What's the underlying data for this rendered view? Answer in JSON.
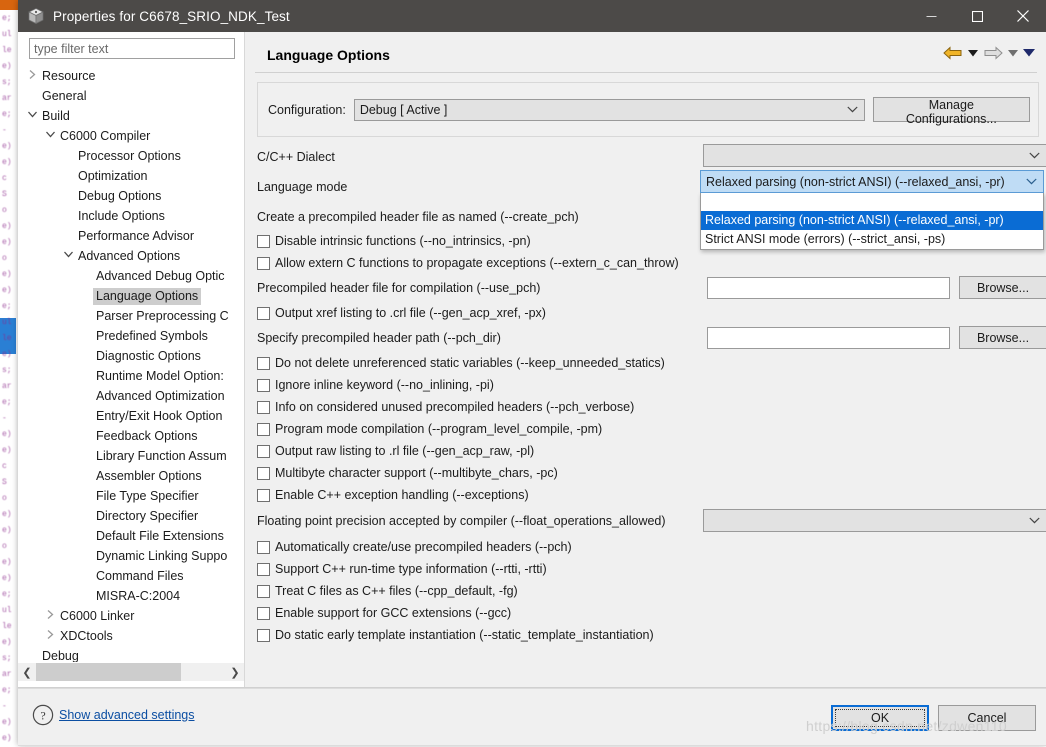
{
  "window": {
    "title": "Properties for C6678_SRIO_NDK_Test",
    "icon": "cube-icon",
    "controls": {
      "minimize": "—",
      "maximize": "☐",
      "close": "✕"
    }
  },
  "sidebar": {
    "filter_placeholder": "type filter text",
    "filter_value": "",
    "items": [
      {
        "label": "Resource",
        "indent": 0,
        "twisty": "collapsed",
        "selected": false
      },
      {
        "label": "General",
        "indent": 0,
        "twisty": "none",
        "selected": false
      },
      {
        "label": "Build",
        "indent": 0,
        "twisty": "expanded",
        "selected": false
      },
      {
        "label": "C6000 Compiler",
        "indent": 1,
        "twisty": "expanded",
        "selected": false
      },
      {
        "label": "Processor Options",
        "indent": 2,
        "twisty": "none",
        "selected": false
      },
      {
        "label": "Optimization",
        "indent": 2,
        "twisty": "none",
        "selected": false
      },
      {
        "label": "Debug Options",
        "indent": 2,
        "twisty": "none",
        "selected": false
      },
      {
        "label": "Include Options",
        "indent": 2,
        "twisty": "none",
        "selected": false
      },
      {
        "label": "Performance Advisor",
        "indent": 2,
        "twisty": "none",
        "selected": false
      },
      {
        "label": "Advanced Options",
        "indent": 2,
        "twisty": "expanded",
        "selected": false
      },
      {
        "label": "Advanced Debug Optic",
        "indent": 3,
        "twisty": "none",
        "selected": false
      },
      {
        "label": "Language Options",
        "indent": 3,
        "twisty": "none",
        "selected": true
      },
      {
        "label": "Parser Preprocessing C",
        "indent": 3,
        "twisty": "none",
        "selected": false
      },
      {
        "label": "Predefined Symbols",
        "indent": 3,
        "twisty": "none",
        "selected": false
      },
      {
        "label": "Diagnostic Options",
        "indent": 3,
        "twisty": "none",
        "selected": false
      },
      {
        "label": "Runtime Model Option:",
        "indent": 3,
        "twisty": "none",
        "selected": false
      },
      {
        "label": "Advanced Optimization",
        "indent": 3,
        "twisty": "none",
        "selected": false
      },
      {
        "label": "Entry/Exit Hook Option",
        "indent": 3,
        "twisty": "none",
        "selected": false
      },
      {
        "label": "Feedback Options",
        "indent": 3,
        "twisty": "none",
        "selected": false
      },
      {
        "label": "Library Function Assum",
        "indent": 3,
        "twisty": "none",
        "selected": false
      },
      {
        "label": "Assembler Options",
        "indent": 3,
        "twisty": "none",
        "selected": false
      },
      {
        "label": "File Type Specifier",
        "indent": 3,
        "twisty": "none",
        "selected": false
      },
      {
        "label": "Directory Specifier",
        "indent": 3,
        "twisty": "none",
        "selected": false
      },
      {
        "label": "Default File Extensions",
        "indent": 3,
        "twisty": "none",
        "selected": false
      },
      {
        "label": "Dynamic Linking Suppo",
        "indent": 3,
        "twisty": "none",
        "selected": false
      },
      {
        "label": "Command Files",
        "indent": 3,
        "twisty": "none",
        "selected": false
      },
      {
        "label": "MISRA-C:2004",
        "indent": 3,
        "twisty": "none",
        "selected": false
      },
      {
        "label": "C6000 Linker",
        "indent": 1,
        "twisty": "collapsed",
        "selected": false
      },
      {
        "label": "XDCtools",
        "indent": 1,
        "twisty": "collapsed",
        "selected": false
      },
      {
        "label": "Debug",
        "indent": 0,
        "twisty": "none",
        "selected": false
      }
    ]
  },
  "content": {
    "page_title": "Language Options",
    "nav": {
      "back_icon": "back-arrow-icon",
      "back_caret": "▾",
      "forward_icon": "forward-arrow-icon",
      "forward_caret": "▾",
      "menu_caret": "▾"
    },
    "configuration": {
      "label": "Configuration:",
      "value": "Debug  [ Active ]",
      "manage_button": "Manage Configurations..."
    },
    "dialect": {
      "label": "C/C++ Dialect",
      "value": ""
    },
    "language_mode": {
      "label": "Language mode",
      "value": "Relaxed parsing (non-strict ANSI) (--relaxed_ansi, -pr)",
      "open": true,
      "options": [
        {
          "label": "",
          "selected": false
        },
        {
          "label": "Relaxed parsing (non-strict ANSI) (--relaxed_ansi, -pr)",
          "selected": true
        },
        {
          "label": "Strict ANSI mode (errors) (--strict_ansi, -ps)",
          "selected": false
        }
      ]
    },
    "options": [
      {
        "type": "label",
        "label": "Create a precompiled header file as named (--create_pch)"
      },
      {
        "type": "checkbox",
        "label": "Disable intrinsic functions (--no_intrinsics, -pn)",
        "checked": false
      },
      {
        "type": "checkbox",
        "label": "Allow extern C functions to propagate exceptions (--extern_c_can_throw)",
        "checked": false
      },
      {
        "type": "field",
        "label": "Precompiled header file for compilation (--use_pch)",
        "value": "",
        "browse": "Browse..."
      },
      {
        "type": "checkbox",
        "label": "Output xref listing to .crl file (--gen_acp_xref, -px)",
        "checked": false
      },
      {
        "type": "field",
        "label": "Specify precompiled header path (--pch_dir)",
        "value": "",
        "browse": "Browse..."
      },
      {
        "type": "checkbox",
        "label": "Do not delete unreferenced static variables (--keep_unneeded_statics)",
        "checked": false
      },
      {
        "type": "checkbox",
        "label": "Ignore inline keyword (--no_inlining, -pi)",
        "checked": false
      },
      {
        "type": "checkbox",
        "label": "Info on considered  unused precompiled headers (--pch_verbose)",
        "checked": false
      },
      {
        "type": "checkbox",
        "label": "Program mode compilation (--program_level_compile, -pm)",
        "checked": false
      },
      {
        "type": "checkbox",
        "label": "Output raw listing to .rl file (--gen_acp_raw, -pl)",
        "checked": false
      },
      {
        "type": "checkbox",
        "label": "Multibyte character support (--multibyte_chars, -pc)",
        "checked": false
      },
      {
        "type": "checkbox",
        "label": "Enable C++ exception handling (--exceptions)",
        "checked": false
      },
      {
        "type": "combo",
        "label": "Floating point precision accepted by compiler (--float_operations_allowed)",
        "value": ""
      },
      {
        "type": "checkbox",
        "label": "Automatically create/use precompiled headers (--pch)",
        "checked": false
      },
      {
        "type": "checkbox",
        "label": "Support C++ run-time type information (--rtti, -rtti)",
        "checked": false
      },
      {
        "type": "checkbox",
        "label": "Treat C files as C++ files (--cpp_default, -fg)",
        "checked": false
      },
      {
        "type": "checkbox",
        "label": "Enable support for GCC extensions (--gcc)",
        "checked": false
      },
      {
        "type": "checkbox",
        "label": "Do static early template instantiation (--static_template_instantiation)",
        "checked": false
      }
    ]
  },
  "footer": {
    "help_icon": "question-mark-icon",
    "advanced_link": "Show advanced settings",
    "ok_button": "OK",
    "cancel_button": "Cancel"
  },
  "watermark": "https://blog.csdn.net/zdwen110",
  "colors": {
    "titlebar": "#4c4a48",
    "dialog_bg": "#f0f0f0",
    "accent_blue": "#0a6cd4",
    "combo_focus": "#bfdcf5",
    "link": "#0b4ea2",
    "tree_selected": "#cdcdcd"
  }
}
